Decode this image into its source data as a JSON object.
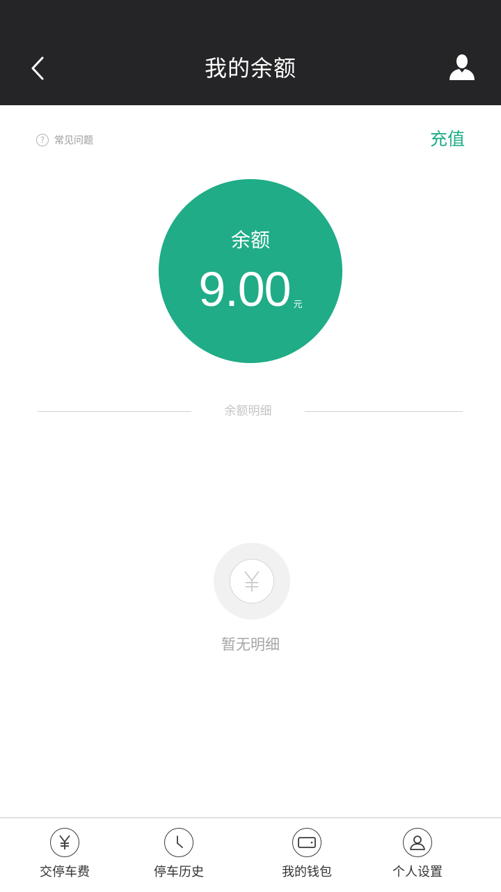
{
  "header": {
    "title": "我的余额",
    "back_icon": "chevron-left-icon",
    "profile_icon": "user-silhouette-icon"
  },
  "top_bar": {
    "faq_label": "常见问题",
    "faq_icon_glyph": "?",
    "recharge_label": "充值"
  },
  "balance": {
    "label": "余额",
    "amount": "9.00",
    "unit": "元"
  },
  "details": {
    "section_title": "余额明细",
    "empty_icon_glyph": "¥",
    "empty_text": "暂无明细"
  },
  "bottom_nav": {
    "items": [
      {
        "label": "交停车费",
        "icon": "yen-coin-icon"
      },
      {
        "label": "停车历史",
        "icon": "clock-icon"
      },
      {
        "label": "我的钱包",
        "icon": "wallet-icon"
      },
      {
        "label": "个人设置",
        "icon": "person-icon"
      }
    ]
  },
  "colors": {
    "header_bg": "#252527",
    "accent": "#1fac87",
    "divider": "#cfcfcf"
  }
}
